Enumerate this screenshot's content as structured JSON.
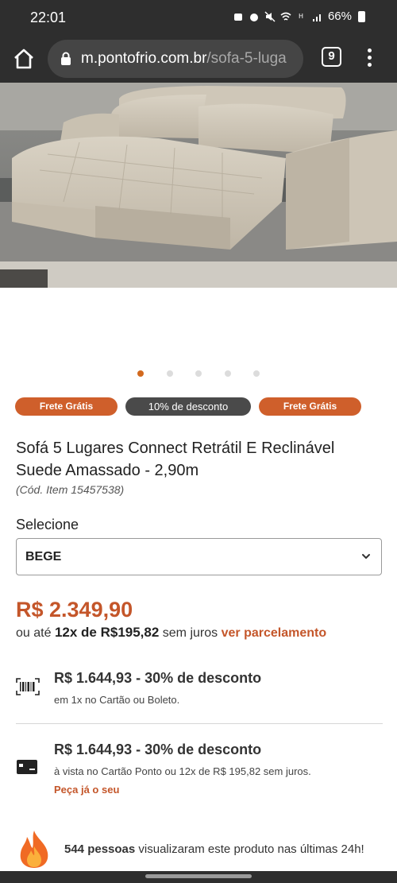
{
  "status_bar": {
    "time": "22:01",
    "battery": "66%"
  },
  "browser": {
    "url_domain": "m.pontofrio.com.br",
    "url_path": "/sofa-5-luga",
    "tab_count": "9"
  },
  "carousel": {
    "dot_count": 5,
    "active_index": 0
  },
  "badges": {
    "free_shipping_1": "Frete Grátis",
    "discount": "10% de desconto",
    "free_shipping_2": "Frete Grátis"
  },
  "product": {
    "title": "Sofá 5 Lugares Connect Retrátil E Reclinável Suede Amassado - 2,90m",
    "code": "(Cód. Item 15457538)"
  },
  "variant": {
    "label": "Selecione",
    "selected": "BEGE"
  },
  "pricing": {
    "price": "R$ 2.349,90",
    "installments_prefix": "ou até",
    "installments_value": "12x de R$195,82",
    "installments_suffix": "sem juros",
    "installments_link": "ver parcelamento"
  },
  "payment_options": [
    {
      "title": "R$ 1.644,93 - 30% de desconto",
      "subtitle": "em 1x no Cartão ou Boleto.",
      "icon": "barcode-icon"
    },
    {
      "title": "R$ 1.644,93 - 30% de desconto",
      "subtitle": "à vista no Cartão Ponto ou 12x de R$ 195,82 sem juros.",
      "link": "Peça já o seu",
      "icon": "credit-card-icon"
    }
  ],
  "social_proof": {
    "count": "544 pessoas",
    "text": " visualizaram este produto nas últimas 24h!"
  },
  "colors": {
    "accent": "#c4562a",
    "badge_orange": "#cf5f2b",
    "badge_dark": "#4a4a4a",
    "chrome": "#2e2e2e"
  }
}
